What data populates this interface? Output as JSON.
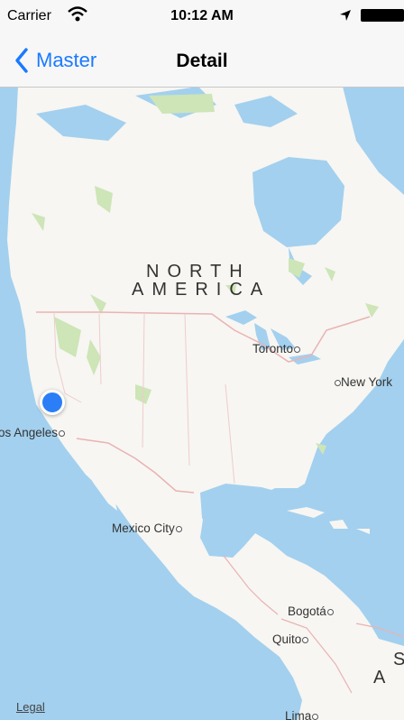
{
  "status_bar": {
    "carrier": "Carrier",
    "time": "10:12 AM",
    "icons": [
      "wifi-icon",
      "location-arrow-icon",
      "battery-icon"
    ]
  },
  "nav_bar": {
    "back_label": "Master",
    "title": "Detail"
  },
  "map": {
    "region_label_line1": "NORTH",
    "region_label_line2": "AMERICA",
    "region_label_partial_line1": "S",
    "region_label_partial_line2": "A M",
    "cities": {
      "toronto": "Toronto",
      "new_york": "New York",
      "los_angeles": "os Angeles",
      "mexico_city": "Mexico City",
      "bogota": "Bogotá",
      "quito": "Quito",
      "lima": "Lima"
    },
    "legal": "Legal"
  },
  "colors": {
    "accent": "#1a7aff",
    "user_location": "#2b7ef6",
    "water": "#a3d0ee",
    "land": "#f7f6f2",
    "park": "#cde5b7"
  }
}
